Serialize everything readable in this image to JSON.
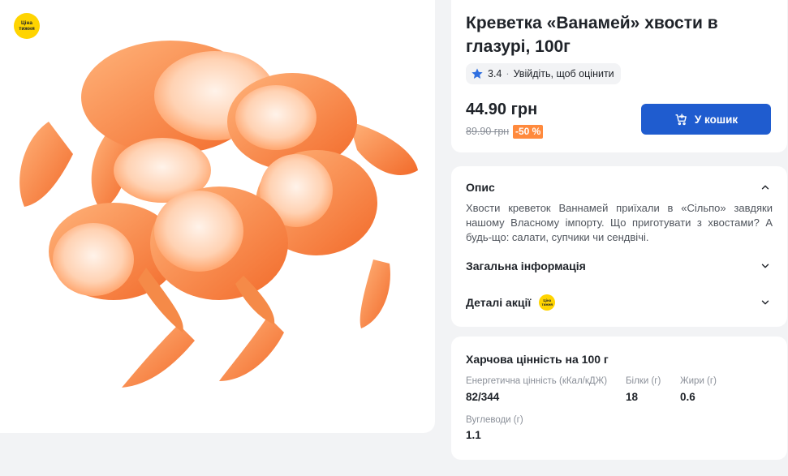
{
  "promo_badge": {
    "line1": "Ціна",
    "line2": "тижня"
  },
  "product": {
    "title": "Креветка «Ванамей» хвости в глазурі, 100г",
    "rating": "3.4",
    "rate_prompt": "Увійдіть, щоб оцінити",
    "price": "44.90 грн",
    "old_price": "89.90 грн",
    "discount": "-50 %",
    "cart_button": "У кошик"
  },
  "sections": {
    "description_title": "Опис",
    "description_text": "Хвости креветок Ваннамей приїхали в «Сільпо» завдяки нашому Власному імпорту. Що приготувати з хвостами? А будь-що: салати, супчики чи сендвічі.",
    "general_info_title": "Загальна інформація",
    "promo_details_title": "Деталі акції"
  },
  "nutrition": {
    "title": "Харчова цінність на 100 г",
    "energy_label": "Енергетична цінність (кКал/кДЖ)",
    "energy_value": "82/344",
    "protein_label": "Білки (г)",
    "protein_value": "18",
    "fat_label": "Жири (г)",
    "fat_value": "0.6",
    "carbs_label": "Вуглеводи (г)",
    "carbs_value": "1.1"
  },
  "colors": {
    "accent": "#1f5ccf",
    "discount": "#ff8a3d",
    "promo": "#ffd400",
    "star": "#2f6fe0"
  }
}
